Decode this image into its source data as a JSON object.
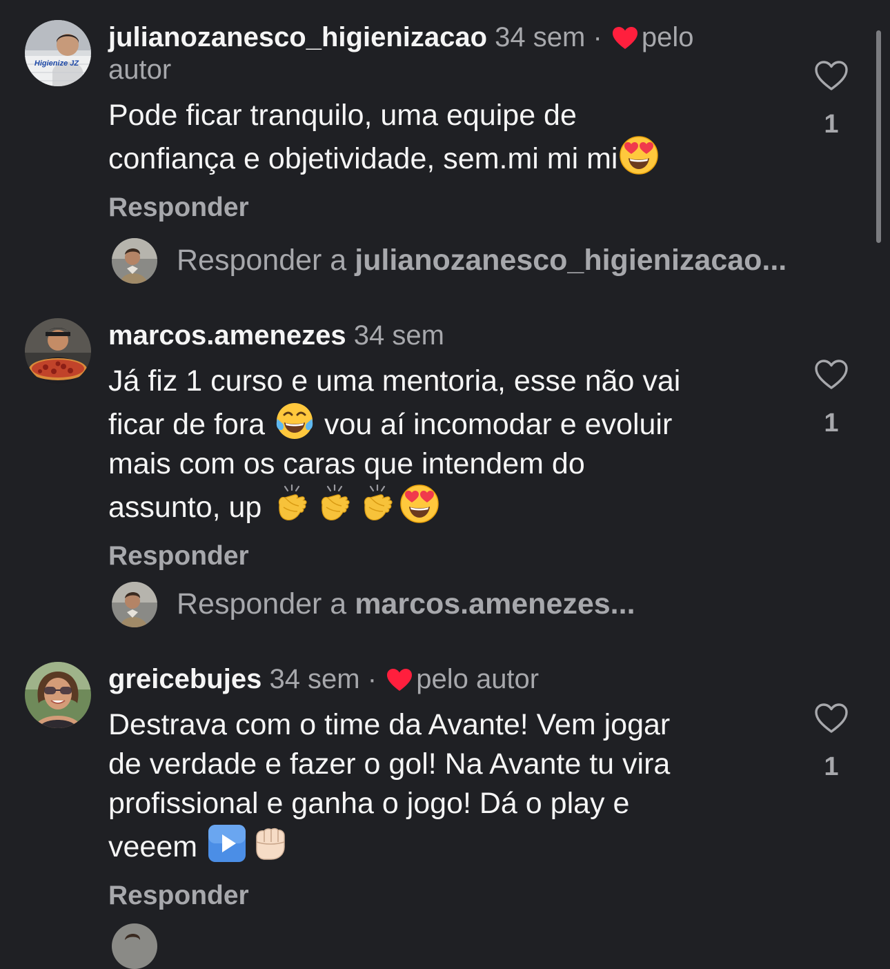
{
  "comments": [
    {
      "username": "julianozanesco_higienizacao",
      "time": "34 sem",
      "separator": "·",
      "liked_by_author_label": "pelo autor",
      "liked_by_author_label_line1": "pelo",
      "liked_by_author_label_line2": "autor",
      "avatar_caption": "Higienize JZ",
      "lines": [
        "Pode ficar tranquilo, uma equipe  de",
        "confiança  e objetividade, sem.mi mi mi"
      ],
      "line_emojis": [
        [],
        [
          "heart-eyes-emoji"
        ]
      ],
      "reply_label": "Responder",
      "like_count": "1",
      "reply_prompt": "Responder a",
      "reply_target": "julianozanesco_higienizacao..."
    },
    {
      "username": "marcos.amenezes",
      "time": "34 sem",
      "lines": [
        "Já fiz 1 curso e uma mentoria, esse não vai",
        "ficar de fora",
        "vou aí incomodar e evoluir",
        "mais com os caras que intendem do",
        "assunto, up"
      ],
      "reply_label": "Responder",
      "like_count": "1",
      "reply_prompt": "Responder a",
      "reply_target": "marcos.amenezes..."
    },
    {
      "username": "greicebujes",
      "time": "34 sem",
      "separator": "·",
      "liked_by_author_label": "pelo autor",
      "lines": [
        "Destrava com o time da Avante! Vem jogar",
        "de verdade e fazer o gol! Na Avante tu vira",
        "profissional e ganha o jogo! Dá o play e",
        "veeem"
      ],
      "reply_label": "Responder",
      "like_count": "1"
    }
  ],
  "icons": {
    "like": "heart-outline-icon",
    "liked_by_author": "red-heart-icon",
    "emojis": [
      "heart-eyes-emoji",
      "tears-of-joy-emoji",
      "clapping-hands-emoji",
      "play-button-emoji",
      "fist-bump-emoji"
    ]
  },
  "colors": {
    "background": "#1f2024",
    "text_primary": "#f5f5f5",
    "text_secondary": "#a7a8ac",
    "heart_red": "#ff1f3d",
    "scrollbar": "#7b7c80"
  }
}
